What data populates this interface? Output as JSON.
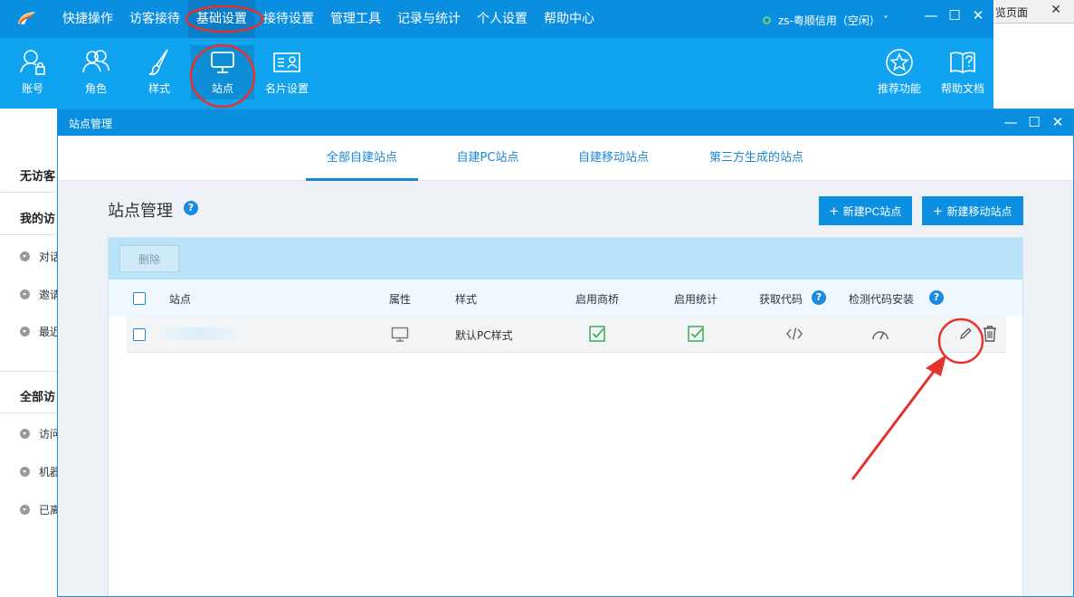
{
  "background_window": {
    "tab_label": "览页面",
    "close": "✕"
  },
  "topbar": {
    "menu": [
      {
        "label": "快捷操作"
      },
      {
        "label": "访客接待"
      },
      {
        "label": "基础设置"
      },
      {
        "label": "接待设置"
      },
      {
        "label": "管理工具"
      },
      {
        "label": "记录与统计"
      },
      {
        "label": "个人设置"
      },
      {
        "label": "帮助中心"
      }
    ],
    "status": "zs-粤顺信用（空闲）",
    "status_caret": "˅",
    "win": {
      "min": "—",
      "max": "☐",
      "close": "✕"
    }
  },
  "toolbar": {
    "items": [
      {
        "label": "账号",
        "icon": "account-icon"
      },
      {
        "label": "角色",
        "icon": "role-icon"
      },
      {
        "label": "样式",
        "icon": "brush-icon"
      },
      {
        "label": "站点",
        "icon": "monitor-icon"
      },
      {
        "label": "名片设置",
        "icon": "card-icon"
      }
    ],
    "right_items": [
      {
        "label": "推荐功能",
        "icon": "star-icon"
      },
      {
        "label": "帮助文档",
        "icon": "help-doc-icon"
      }
    ]
  },
  "sidebar": {
    "groups": [
      {
        "label": "无访客"
      },
      {
        "label": "我的访"
      },
      {
        "label": "全部访"
      }
    ],
    "items": [
      {
        "label": "对话"
      },
      {
        "label": "邀请"
      },
      {
        "label": "最近"
      },
      {
        "label": "访问"
      },
      {
        "label": "机器"
      },
      {
        "label": "已离"
      }
    ]
  },
  "dialog": {
    "title": "站点管理",
    "win": {
      "min": "—",
      "max": "☐",
      "close": "✕"
    },
    "tabs": [
      {
        "label": "全部自建站点",
        "active": true
      },
      {
        "label": "自建PC站点",
        "active": false
      },
      {
        "label": "自建移动站点",
        "active": false
      },
      {
        "label": "第三方生成的站点",
        "active": false
      }
    ],
    "page_title": "站点管理",
    "help": "?",
    "btn_new_pc": "新建PC站点",
    "btn_new_mobile": "新建移动站点",
    "plus": "+",
    "btn_delete": "删除",
    "table": {
      "headers": {
        "site": "站点",
        "attr": "属性",
        "style": "样式",
        "shangqiao": "启用商桥",
        "stats": "启用统计",
        "getcode": "获取代码",
        "checkcode": "检测代码安装"
      },
      "rows": [
        {
          "site": "",
          "attr_icon": "monitor-icon",
          "style": "默认PC样式",
          "shangqiao": true,
          "stats": true
        }
      ]
    }
  },
  "colors": {
    "topbar": "#0a8fe0",
    "toolbar": "#10a3f0",
    "accent": "#1a86d6",
    "check": "#2fa84f",
    "annotation": "#e5322d"
  }
}
